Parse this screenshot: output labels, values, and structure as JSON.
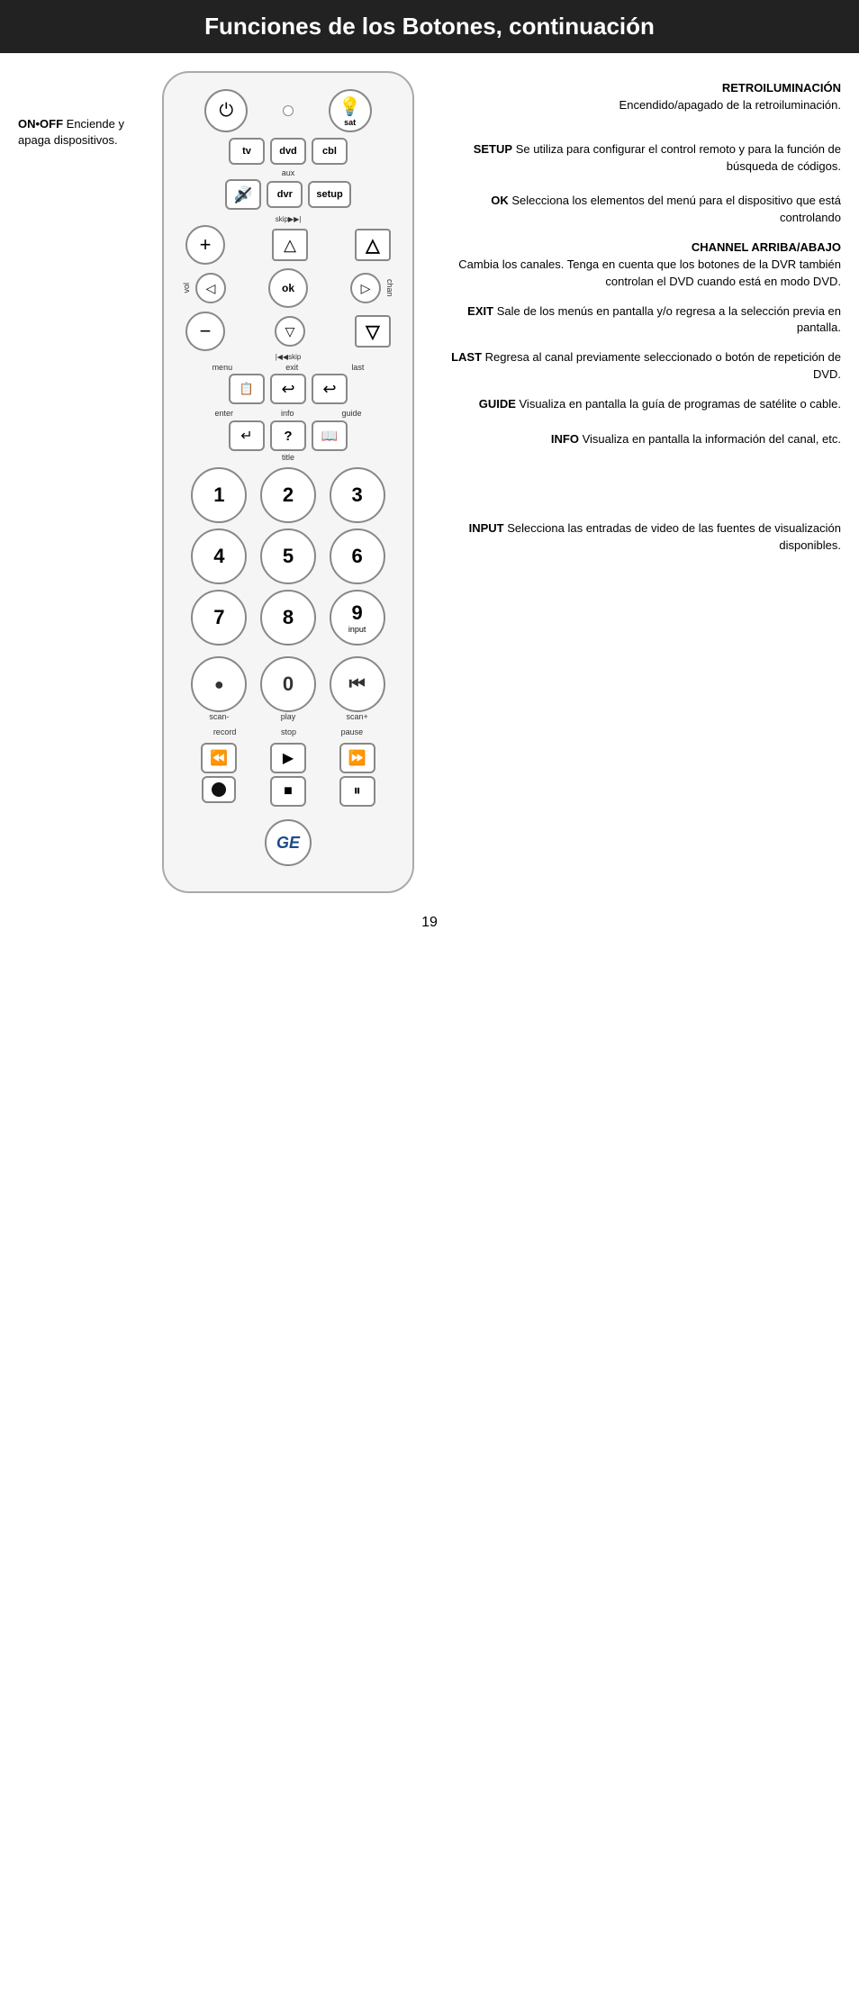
{
  "header": {
    "title": "Funciones de los Botones, continuación"
  },
  "left_annotation": {
    "label_bold": "ON•OFF",
    "label_text": " Enciende y apaga dispositivos."
  },
  "right_annotations": [
    {
      "id": "retroiluminacion",
      "bold": "RETROILUMINACIÓN",
      "text": "Encendido/apagado de la retroiluminación."
    },
    {
      "id": "setup",
      "bold": "SETUP",
      "text": " Se utiliza para configurar el control remoto y para la función de búsqueda de códigos."
    },
    {
      "id": "ok",
      "bold": "OK",
      "text": " Selecciona los elementos del menú para el dispositivo que está controlando"
    },
    {
      "id": "channel",
      "bold": "CHANNEL ARRIBA/ABAJO",
      "text": "Cambia los canales. Tenga en cuenta que los botones de la DVR también controlan el DVD cuando está en modo DVD."
    },
    {
      "id": "exit",
      "bold": "EXIT",
      "text": " Sale de los menús en pantalla y/o regresa a la selección previa en pantalla."
    },
    {
      "id": "last",
      "bold": "LAST",
      "text": " Regresa al canal previamente seleccionado o botón de repetición de DVD."
    },
    {
      "id": "guide",
      "bold": "GUIDE",
      "text": " Visualiza en pantalla la guía de programas de satélite o cable."
    },
    {
      "id": "info",
      "bold": "INFO",
      "text": " Visualiza en pantalla la información del canal, etc."
    },
    {
      "id": "input",
      "bold": "INPUT",
      "text": " Selecciona las entradas de video de las fuentes de visualización disponibles."
    }
  ],
  "buttons": {
    "tv": "tv",
    "dvd": "dvd",
    "cbl": "cbl",
    "aux": "aux",
    "dvr": "dvr",
    "setup": "setup",
    "ok": "ok",
    "menu": "menu",
    "exit": "exit",
    "last": "last",
    "enter": "enter",
    "info": "info",
    "guide": "guide",
    "title": "title",
    "scan_minus": "scan-",
    "play": "play",
    "scan_plus": "scan+",
    "record": "record",
    "stop": "stop",
    "pause": "pause",
    "skip_right": "skip▶▶|",
    "skip_left": "|◀◀skip",
    "numbers": [
      "1",
      "2",
      "3",
      "4",
      "5",
      "6",
      "7",
      "8",
      "9",
      "●",
      "0",
      ""
    ],
    "num9_label": "input",
    "vol": "vol",
    "chan": "chan"
  },
  "page_number": "19",
  "ge_logo": "GE"
}
